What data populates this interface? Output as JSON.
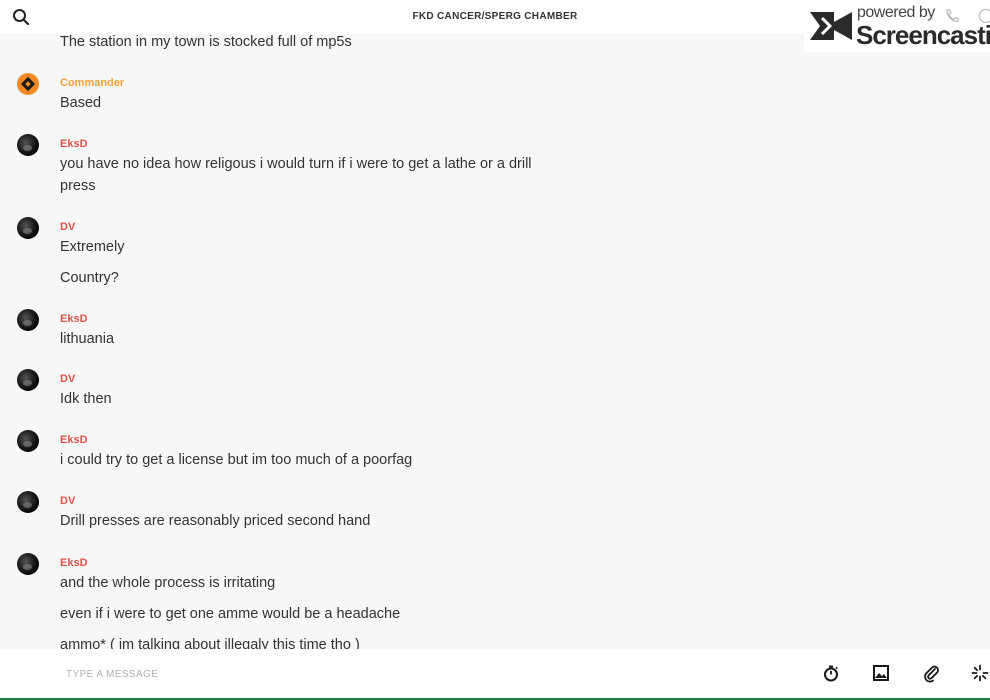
{
  "header": {
    "title": "FKD CANCER/SPERG CHAMBER"
  },
  "watermark": {
    "powered_by": "powered by",
    "brand": "Screencastify"
  },
  "messages": [
    {
      "author": "",
      "lines": [
        "The station in my town is stocked full of mp5s"
      ]
    },
    {
      "author": "Commander",
      "lines": [
        "Based"
      ]
    },
    {
      "author": "EksD",
      "lines": [
        "you have no idea how religous i would turn if i were to get a lathe or a drill",
        "press"
      ]
    },
    {
      "author": "DV",
      "lines": [
        "Extremely",
        "Country?"
      ]
    },
    {
      "author": "EksD",
      "lines": [
        "lithuania"
      ]
    },
    {
      "author": "DV",
      "lines": [
        "Idk then"
      ]
    },
    {
      "author": "EksD",
      "lines": [
        "i could try to get a license but im too much of a poorfag"
      ]
    },
    {
      "author": "DV",
      "lines": [
        "Drill presses are reasonably priced second hand"
      ]
    },
    {
      "author": "EksD",
      "lines": [
        "and the whole process is irritating",
        "even if i were to get one amme would be a headache",
        "ammo* ( im talking about illegaly this time tho )"
      ]
    }
  ],
  "input": {
    "placeholder": "TYPE A MESSAGE",
    "value": ""
  },
  "toolbar": {
    "icons": [
      "timer-icon",
      "image-icon",
      "attachment-icon",
      "sparkle-icon"
    ]
  },
  "colors": {
    "author_red": "#e0544b",
    "author_orange": "#f0a23a"
  }
}
